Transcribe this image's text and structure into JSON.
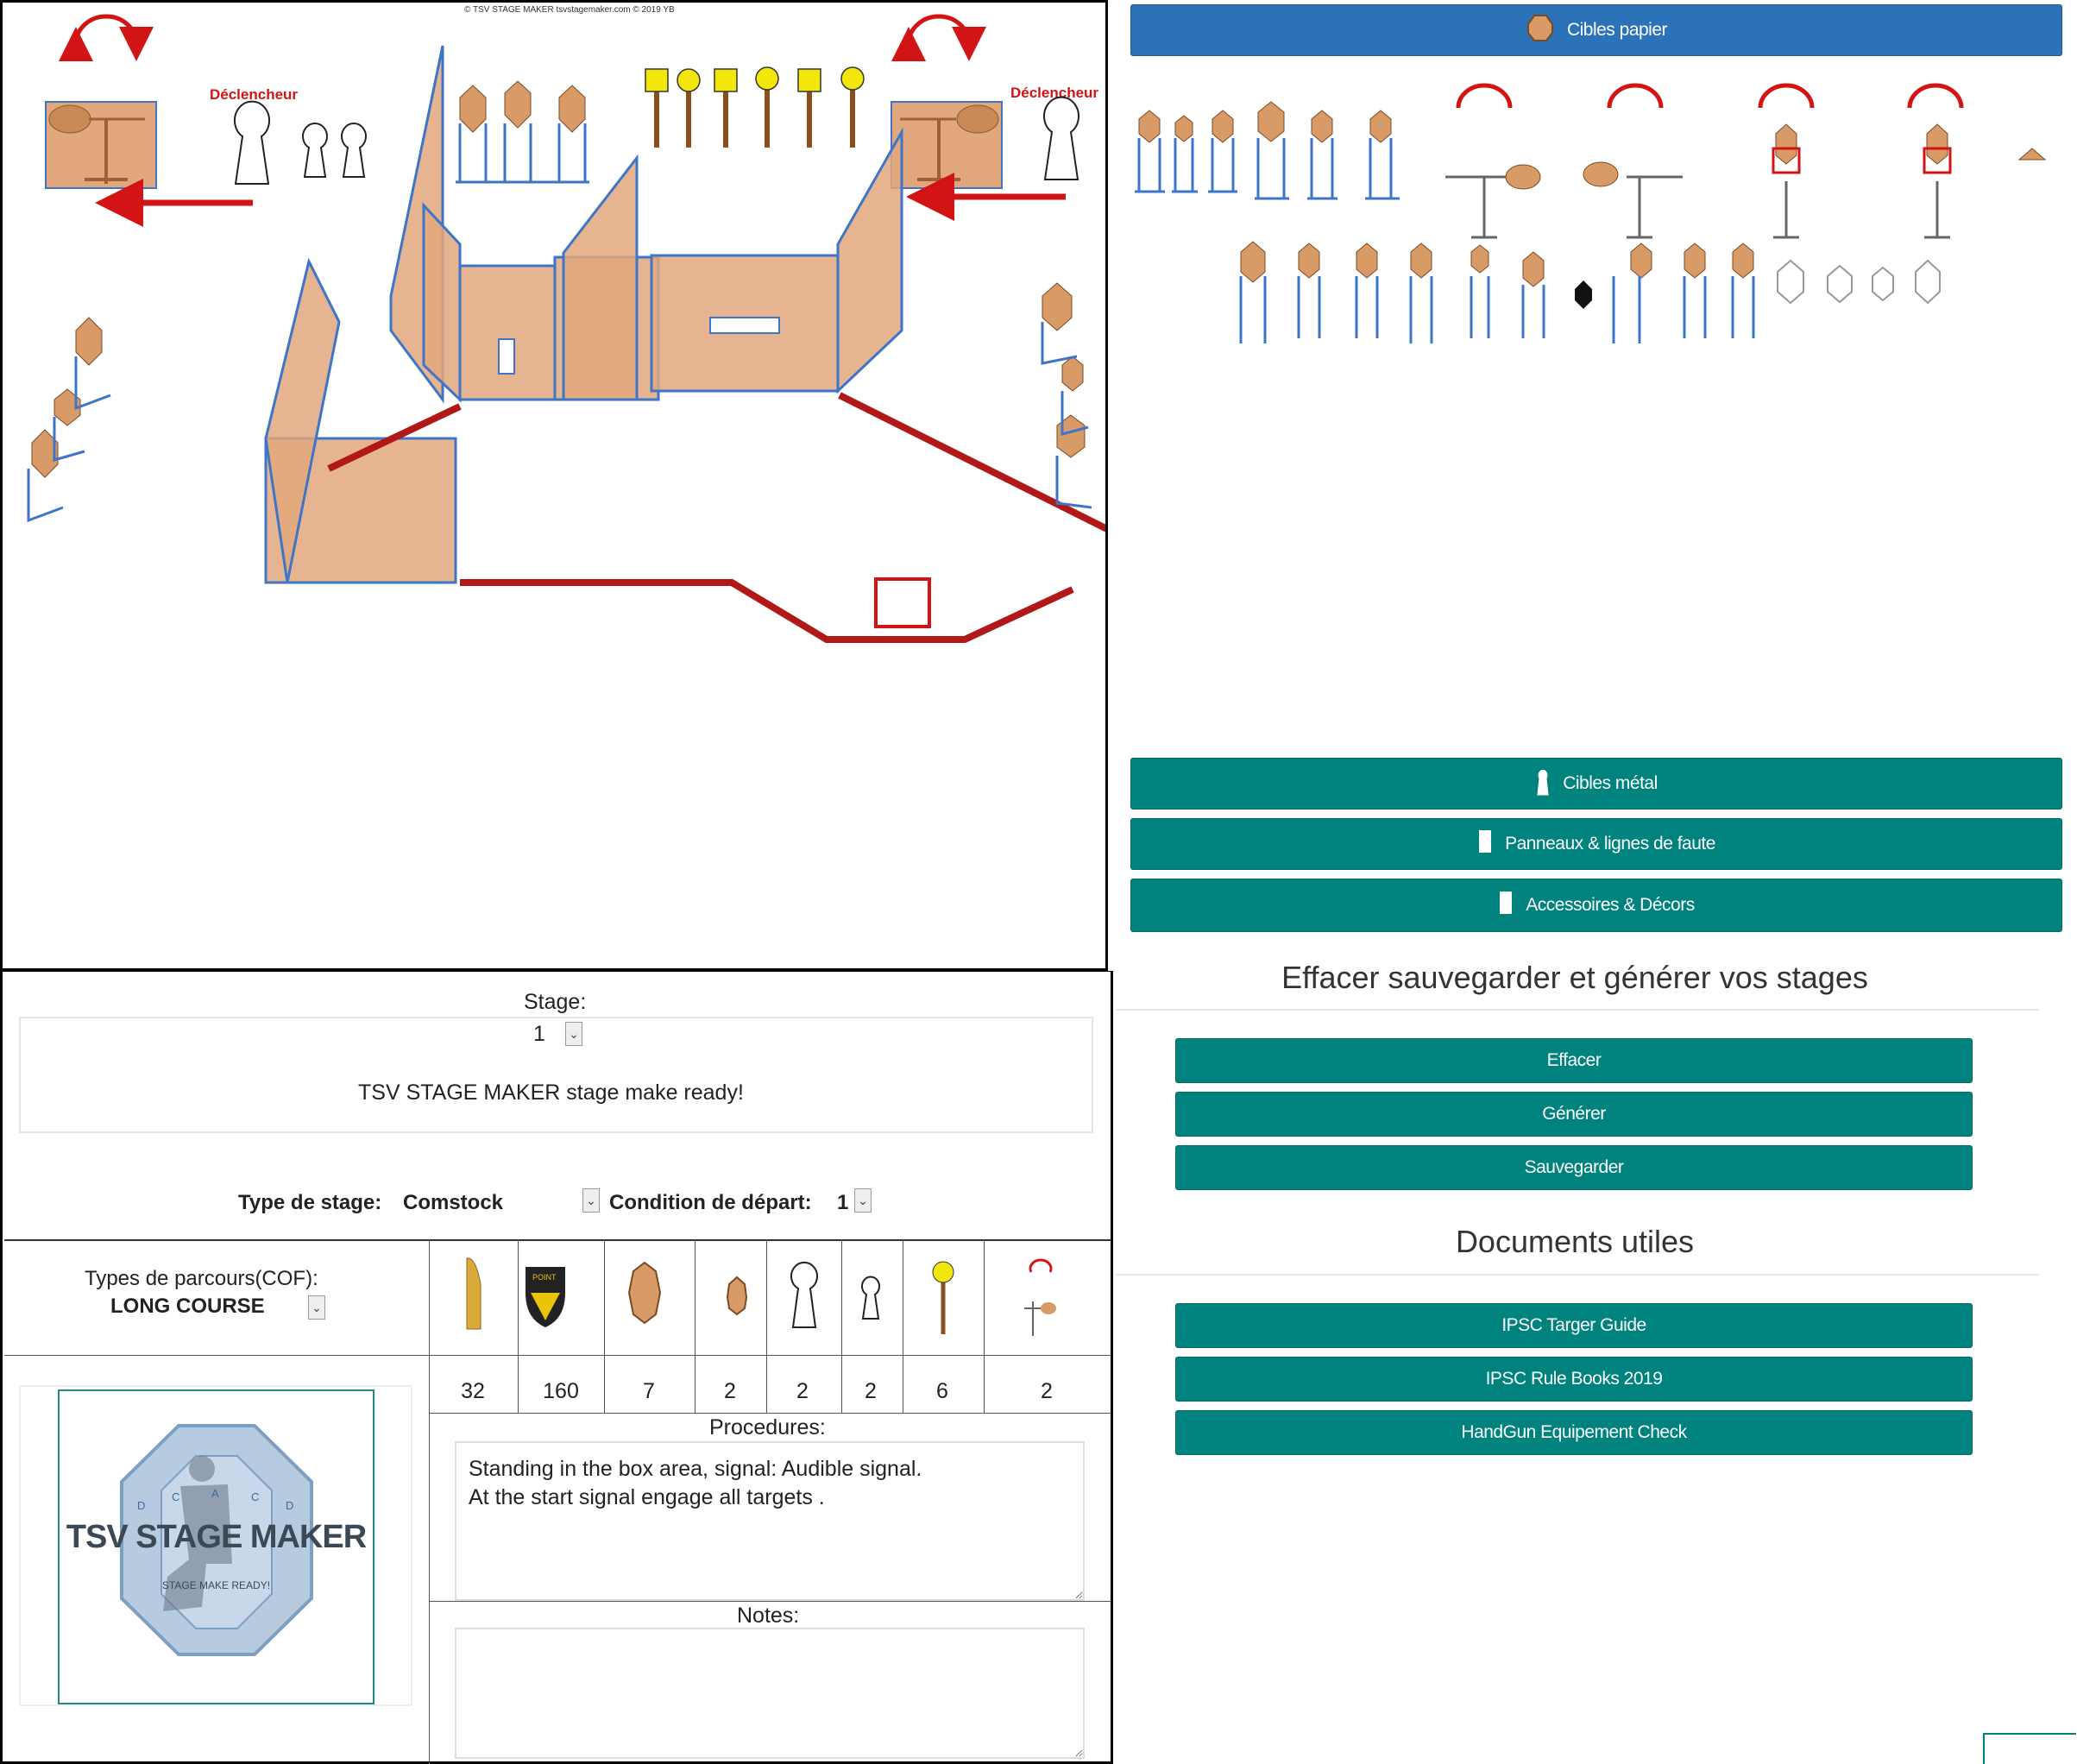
{
  "canvas": {
    "copyright": "© TSV STAGE MAKER tsvstagemaker.com © 2019 YB",
    "trigger_left": "Déclencheur",
    "trigger_right": "Déclencheur"
  },
  "stage": {
    "label": "Stage:",
    "number": "1",
    "title": "TSV STAGE MAKER stage make ready!",
    "type_label": "Type de stage:",
    "type_value": "Comstock",
    "condition_label": "Condition de départ:",
    "condition_value": "1",
    "cof_label": "Types de parcours(COF):",
    "cof_value": "LONG COURSE"
  },
  "counts": {
    "rounds": "32",
    "points": "160",
    "paper_targets": "7",
    "mini_targets": "2",
    "poppers": "2",
    "mini_poppers": "2",
    "plates": "6",
    "swingers": "2"
  },
  "badge_text": "POINT",
  "logo": {
    "title": "TSV STAGE MAKER",
    "subtitle": "STAGE MAKE READY!",
    "letters": [
      "D",
      "C",
      "A",
      "C",
      "D"
    ]
  },
  "procedures": {
    "label": "Procedures:",
    "text": "Standing in the box area, signal: Audible signal.\nAt the start signal engage all targets ."
  },
  "notes": {
    "label": "Notes:",
    "text": ""
  },
  "palette": {
    "paper_button": "Cibles papier",
    "metal_button": "Cibles métal",
    "panels_button": "Panneaux & lignes de faute",
    "accessories_button": "Accessoires & Décors"
  },
  "actions": {
    "title": "Effacer sauvegarder et générer vos stages",
    "clear": "Effacer",
    "generate": "Générer",
    "save": "Sauvegarder"
  },
  "documents": {
    "title": "Documents utiles",
    "target_guide": "IPSC Targer Guide",
    "rule_books": "IPSC Rule Books 2019",
    "equipment": "HandGun Equipement Check"
  },
  "colors": {
    "teal": "#00827f",
    "blue": "#2c72b8",
    "panel": "#e2a77c",
    "fault_line": "#b11818",
    "stand": "#3d76c9"
  }
}
